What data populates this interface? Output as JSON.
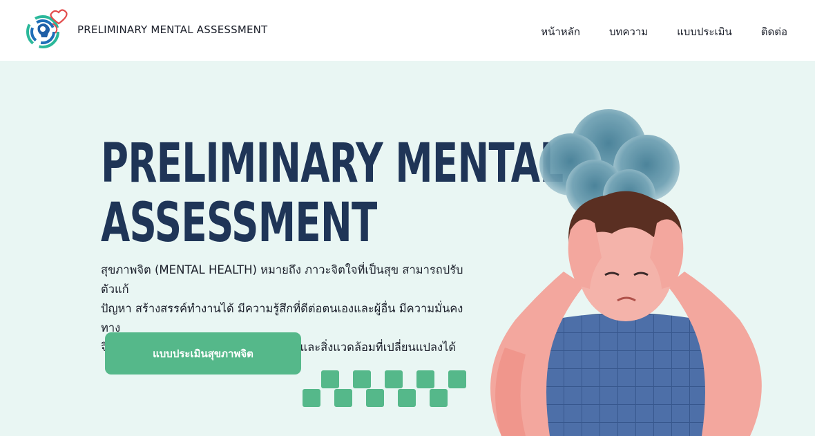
{
  "header": {
    "brand": "PRELIMINARY MENTAL ASSESSMENT",
    "nav": [
      {
        "label": "หน้าหลัก"
      },
      {
        "label": "บทความ"
      },
      {
        "label": "แบบประเมิน"
      },
      {
        "label": "ติดต่อ"
      }
    ]
  },
  "hero": {
    "title_line1": "PRELIMINARY MENTAL",
    "title_line2": "ASSESSMENT",
    "description_line1": "สุขภาพจิต (MENTAL HEALTH) หมายถึง ภาวะจิตใจที่เป็นสุข สามารถปรับตัวแก้",
    "description_line2": "ปัญหา สร้างสรรค์ทำงานได้ มีความรู้สึกที่ดีต่อตนเองและผู้อื่น มีความมั่นคงทาง",
    "description_line3": "จิตใจ มีวุฒิภาวะทางอารมณ์ อยู่ในสังคม และสิ่งแวดล้อมที่เปลี่ยนแปลงได้",
    "cta_label": "แบบประเมินสุขภาพจิต"
  },
  "icons": {
    "logo": "mental-health-head-heart-logo-icon",
    "illustration": "stressed-person-holding-head-icon",
    "pattern": "checker-pattern-icon"
  },
  "colors": {
    "navy": "#1f3557",
    "green": "#55b88a",
    "background": "#e9f6f3",
    "header_bg": "#ffffff"
  }
}
